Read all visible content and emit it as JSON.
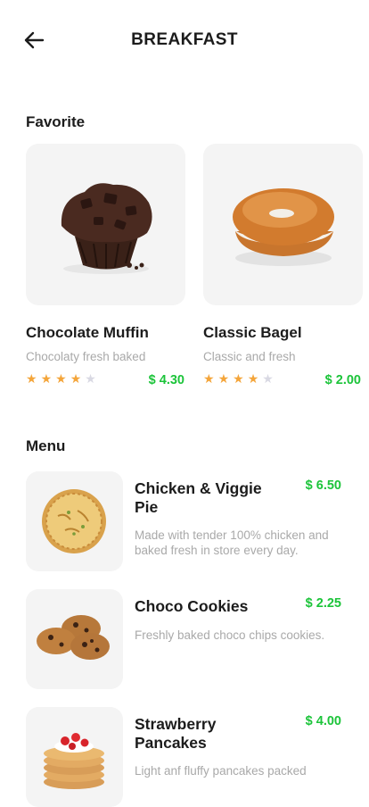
{
  "header": {
    "title": "BREAKFAST"
  },
  "favorite": {
    "title": "Favorite",
    "items": [
      {
        "name": "Chocolate Muffin",
        "desc": "Chocolaty fresh baked",
        "price": "$ 4.30",
        "rating": 4,
        "max_rating": 5
      },
      {
        "name": "Classic Bagel",
        "desc": "Classic and fresh",
        "price": "$ 2.00",
        "rating": 4,
        "max_rating": 5
      }
    ]
  },
  "menu": {
    "title": "Menu",
    "items": [
      {
        "name": "Chicken & Viggie Pie",
        "price": "$ 6.50",
        "desc": "Made with tender 100% chicken and baked fresh in store every day."
      },
      {
        "name": "Choco Cookies",
        "price": "$ 2.25",
        "desc": "Freshly baked choco chips cookies."
      },
      {
        "name": "Strawberry Pancakes",
        "price": "$ 4.00",
        "desc": "Light anf fluffy pancakes packed"
      }
    ]
  },
  "colors": {
    "price": "#1cc43a",
    "star_on": "#f4a53a",
    "star_off": "#d9d9e3",
    "card_bg": "#f4f4f4"
  }
}
